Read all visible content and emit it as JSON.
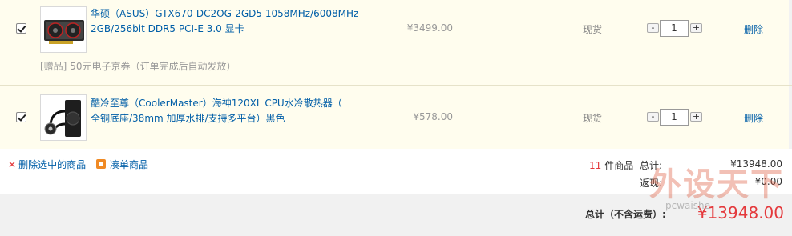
{
  "items": [
    {
      "name_line1": "华硕（ASUS）GTX670-DC2OG-2GD5 1058MHz/6008MHz",
      "name_line2": "2GB/256bit DDR5 PCI-E 3.0 显卡",
      "price": "¥3499.00",
      "stock": "现货",
      "quantity": "1",
      "delete_label": "删除",
      "gift": "[赠品] 50元电子京券（订单完成后自动发放）",
      "checked": true
    },
    {
      "name_line1": "酷冷至尊（CoolerMaster）海神120XL CPU水冷散热器（",
      "name_line2": "全铜底座/38mm 加厚水排/支持多平台）黑色",
      "price": "¥578.00",
      "stock": "现货",
      "quantity": "1",
      "delete_label": "删除",
      "checked": true
    }
  ],
  "qty_controls": {
    "minus": "-",
    "plus": "+"
  },
  "actions": {
    "delete_selected": "删除选中的商品",
    "coudan": "凑单商品"
  },
  "summary": {
    "count": "11",
    "count_unit": "件商品",
    "total_label": "总计:",
    "total_value": "¥13948.00",
    "rebate_label": "返现:",
    "rebate_value": "-¥0.00",
    "grand_label": "总计（不含运费）:",
    "grand_value": "¥13948.00"
  },
  "watermark": {
    "text": "外设天下",
    "sub": "pcwaishe"
  },
  "colors": {
    "accent_red": "#e4393c",
    "link_blue": "#005ea7",
    "row_bg": "#fffdee"
  }
}
